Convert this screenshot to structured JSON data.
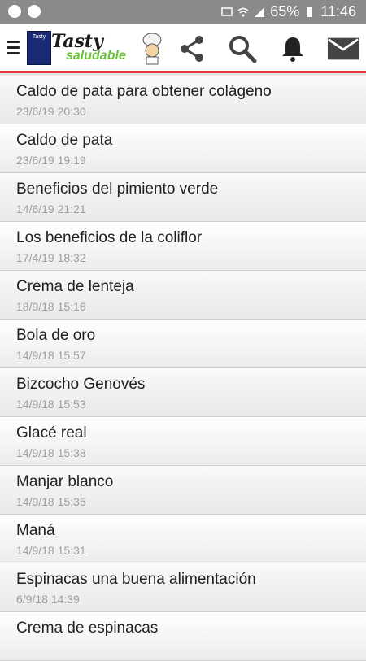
{
  "status_bar": {
    "battery": "65%",
    "time": "11:46"
  },
  "app_bar": {
    "logo_main": "Tasty",
    "logo_sub": "saludable",
    "book_text": "Tasty"
  },
  "items": [
    {
      "title": "Caldo de pata para obtener colágeno",
      "date": "23/6/19 20:30"
    },
    {
      "title": "Caldo de pata",
      "date": "23/6/19 19:19"
    },
    {
      "title": "Beneficios del pimiento verde",
      "date": "14/6/19 21:21"
    },
    {
      "title": "Los beneficios de la coliflor",
      "date": "17/4/19 18:32"
    },
    {
      "title": "Crema de lenteja",
      "date": "18/9/18 15:16"
    },
    {
      "title": "Bola de oro",
      "date": "14/9/18 15:57"
    },
    {
      "title": "Bizcocho Genovés",
      "date": "14/9/18 15:53"
    },
    {
      "title": "Glacé real",
      "date": "14/9/18 15:38"
    },
    {
      "title": "Manjar blanco",
      "date": "14/9/18 15:35"
    },
    {
      "title": "Maná",
      "date": "14/9/18 15:31"
    },
    {
      "title": "Espinacas una buena alimentación",
      "date": "6/9/18 14:39"
    },
    {
      "title": "Crema de espinacas",
      "date": ""
    }
  ],
  "colors": {
    "accent_line": "#e53935",
    "status_bar": "#8a8a8a"
  }
}
